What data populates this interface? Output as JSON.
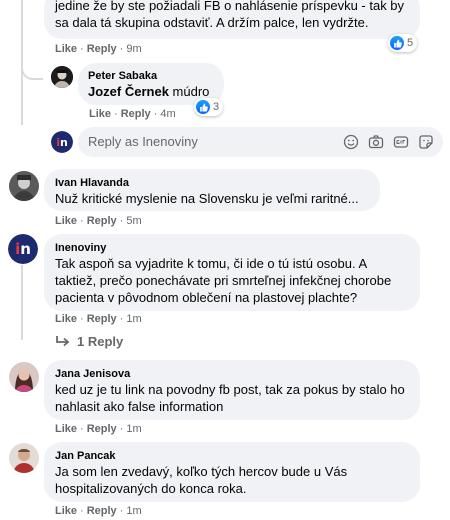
{
  "comments": [
    {
      "id": "c0",
      "text": "jedine že by ste požiadali FB o nahlásenie príspevku - tak by sa dala tá skupina odstaviť. A držím palce, len vydržte.",
      "actions": {
        "like": "Like",
        "reply": "Reply",
        "time": "9m"
      },
      "reaction_count": "5",
      "replies": [
        {
          "author": "Peter Sabaka",
          "mention": "Jozef Černek",
          "text": "múdro",
          "actions": {
            "like": "Like",
            "reply": "Reply",
            "time": "4m"
          },
          "reaction_count": "3"
        }
      ],
      "reply_box": {
        "placeholder": "Reply as Inenoviny"
      }
    },
    {
      "id": "c1",
      "author": "Ivan Hlavanda",
      "text": "Nuž kritické myslenie na Slovensku je veľmi raritné...",
      "actions": {
        "like": "Like",
        "reply": "Reply",
        "time": "5m"
      }
    },
    {
      "id": "c2",
      "author": "Inenoviny",
      "text": "Tak aspoň sa vyjadrite k tomu, či ide o tú istú osobu. A taktiež, prečo ponechávate pri smrteľnej infekčnej chorobe pacienta v pôvodnom oblečení na plastovej plachte?",
      "actions": {
        "like": "Like",
        "reply": "Reply",
        "time": "1m"
      },
      "replies_link": "1 Reply"
    },
    {
      "id": "c3",
      "author": "Jana Jenisova",
      "text": "ked uz je tu link na povodny fb post, tak za pokus by stalo ho nahlasit ako false information",
      "actions": {
        "like": "Like",
        "reply": "Reply",
        "time": "1m"
      }
    },
    {
      "id": "c4",
      "author": "Jan Pancak",
      "text": "Ja som len zvedavý, koľko tých hercov bude u Vás hospitalizovaných do konca roka.",
      "actions": {
        "like": "Like",
        "reply": "Reply",
        "time": "1m"
      }
    }
  ],
  "icons": [
    "like-icon",
    "emoji-icon",
    "camera-icon",
    "gif-icon",
    "sticker-icon",
    "reply-arrow-icon"
  ],
  "colors": {
    "bubble": "#f0f2f5",
    "meta": "#65676b",
    "like_blue": "#0866ff",
    "brand_navy": "#1e2a6e",
    "brand_red": "#e63a3a"
  }
}
